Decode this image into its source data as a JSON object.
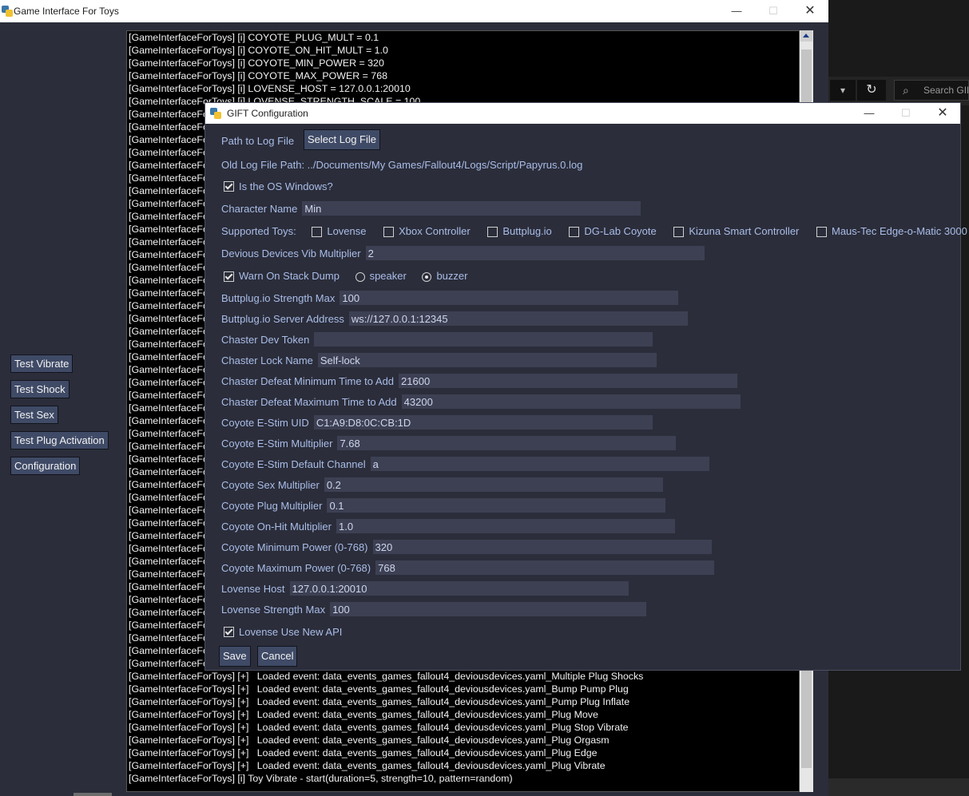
{
  "background_window": {
    "search_placeholder": "Search GIFT",
    "refresh_icon": "refresh-icon",
    "dropdown_icon": "chevron-down-icon"
  },
  "main_window": {
    "title": "Game Interface For Toys",
    "buttons": [
      "Test Vibrate",
      "Test Shock",
      "Test Sex",
      "Test Plug Activation",
      "Configuration"
    ],
    "log_lines": [
      "[GameInterfaceForToys] [i] COYOTE_PLUG_MULT = 0.1",
      "[GameInterfaceForToys] [i] COYOTE_ON_HIT_MULT = 1.0",
      "[GameInterfaceForToys] [i] COYOTE_MIN_POWER = 320",
      "[GameInterfaceForToys] [i] COYOTE_MAX_POWER = 768",
      "[GameInterfaceForToys] [i] LOVENSE_HOST = 127.0.0.1:20010",
      "[GameInterfaceForToys] [i] LOVENSE_STRENGTH_SCALE = 100",
      "[GameInterfaceForToys]",
      "[GameInterfaceForToys]",
      "[GameInterfaceForToys]",
      "[GameInterfaceForToys]",
      "[GameInterfaceForToys]",
      "[GameInterfaceForToys]",
      "[GameInterfaceForToys]",
      "[GameInterfaceForToys]",
      "[GameInterfaceForToys]",
      "[GameInterfaceForToys]",
      "[GameInterfaceForToys]",
      "[GameInterfaceForToys]",
      "[GameInterfaceForToys]",
      "[GameInterfaceForToys]",
      "[GameInterfaceForToys]",
      "[GameInterfaceForToys]",
      "[GameInterfaceForToys]",
      "[GameInterfaceForToys]",
      "[GameInterfaceForToys]",
      "[GameInterfaceForToys]",
      "[GameInterfaceForToys]",
      "[GameInterfaceForToys]",
      "[GameInterfaceForToys]",
      "[GameInterfaceForToys]",
      "[GameInterfaceForToys]",
      "[GameInterfaceForToys]",
      "[GameInterfaceForToys]",
      "[GameInterfaceForToys]",
      "[GameInterfaceForToys]",
      "[GameInterfaceForToys]",
      "[GameInterfaceForToys]",
      "[GameInterfaceForToys]",
      "[GameInterfaceForToys]",
      "[GameInterfaceForToys]",
      "[GameInterfaceForToys]",
      "[GameInterfaceForToys]",
      "[GameInterfaceForToys]",
      "[GameInterfaceForToys]",
      "[GameInterfaceForToys]",
      "[GameInterfaceForToys]",
      "[GameInterfaceForToys]",
      "[GameInterfaceForToys]",
      "[GameInterfaceForToys]",
      "[GameInterfaceForToys]",
      "[GameInterfaceForToys] [+]   Loaded event: data_events_games_fallout4_deviousdevices.yaml_Multiple Plug Shocks",
      "[GameInterfaceForToys] [+]   Loaded event: data_events_games_fallout4_deviousdevices.yaml_Bump Pump Plug",
      "[GameInterfaceForToys] [+]   Loaded event: data_events_games_fallout4_deviousdevices.yaml_Pump Plug Inflate",
      "[GameInterfaceForToys] [+]   Loaded event: data_events_games_fallout4_deviousdevices.yaml_Plug Move",
      "[GameInterfaceForToys] [+]   Loaded event: data_events_games_fallout4_deviousdevices.yaml_Plug Stop Vibrate",
      "[GameInterfaceForToys] [+]   Loaded event: data_events_games_fallout4_deviousdevices.yaml_Plug Orgasm",
      "[GameInterfaceForToys] [+]   Loaded event: data_events_games_fallout4_deviousdevices.yaml_Plug Edge",
      "[GameInterfaceForToys] [+]   Loaded event: data_events_games_fallout4_deviousdevices.yaml_Plug Vibrate",
      "[GameInterfaceForToys] [i] Toy Vibrate - start(duration=5, strength=10, pattern=random)"
    ]
  },
  "config": {
    "title": "GIFT Configuration",
    "path_label": "Path to Log File",
    "select_button": "Select Log File",
    "old_path": "Old Log File Path: ../Documents/My Games/Fallout4/Logs/Script/Papyrus.0.log",
    "is_windows": {
      "label": "Is the OS Windows?",
      "checked": true
    },
    "character_name": {
      "label": "Character Name",
      "value": "Min"
    },
    "supported_toys_label": "Supported Toys:",
    "toys": [
      {
        "label": "Lovense",
        "checked": false
      },
      {
        "label": "Xbox Controller",
        "checked": false
      },
      {
        "label": "Buttplug.io",
        "checked": false
      },
      {
        "label": "DG-Lab Coyote",
        "checked": false
      },
      {
        "label": "Kizuna Smart Controller",
        "checked": false
      },
      {
        "label": "Maus-Tec Edge-o-Matic 3000",
        "checked": false
      }
    ],
    "dd_vib": {
      "label": "Devious Devices Vib Multiplier",
      "value": "2"
    },
    "warn_stack": {
      "label": "Warn On Stack Dump",
      "checked": true
    },
    "radio_speaker": {
      "label": "speaker",
      "checked": false
    },
    "radio_buzzer": {
      "label": "buzzer",
      "checked": true
    },
    "bp_strength": {
      "label": "Buttplug.io Strength Max",
      "value": "100"
    },
    "bp_server": {
      "label": "Buttplug.io Server Address",
      "value": "ws://127.0.0.1:12345"
    },
    "chaster_token": {
      "label": "Chaster Dev Token",
      "value": ""
    },
    "chaster_lock": {
      "label": "Chaster Lock Name",
      "value": "Self-lock"
    },
    "chaster_min": {
      "label": "Chaster Defeat Minimum Time to Add",
      "value": "21600"
    },
    "chaster_max": {
      "label": "Chaster Defeat Maximum Time to Add",
      "value": "43200"
    },
    "coyote_uid": {
      "label": "Coyote E-Stim UID",
      "value": "C1:A9:D8:0C:CB:1D"
    },
    "coyote_mult": {
      "label": "Coyote E-Stim Multiplier",
      "value": "7.68"
    },
    "coyote_channel": {
      "label": "Coyote E-Stim Default Channel",
      "value": "a"
    },
    "coyote_sex": {
      "label": "Coyote Sex Multiplier",
      "value": "0.2"
    },
    "coyote_plug": {
      "label": "Coyote Plug Multiplier",
      "value": "0.1"
    },
    "coyote_hit": {
      "label": "Coyote On-Hit Multiplier",
      "value": "1.0"
    },
    "coyote_minp": {
      "label": "Coyote Minimum Power (0-768)",
      "value": "320"
    },
    "coyote_maxp": {
      "label": "Coyote Maximum Power (0-768)",
      "value": "768"
    },
    "lovense_host": {
      "label": "Lovense Host",
      "value": "127.0.0.1:20010"
    },
    "lovense_strength": {
      "label": "Lovense Strength Max",
      "value": "100"
    },
    "lovense_api": {
      "label": "Lovense Use New API",
      "checked": true
    },
    "save_button": "Save",
    "cancel_button": "Cancel"
  },
  "colors": {
    "window_bg": "#2b2d3a",
    "label_text": "#a9bde8",
    "input_bg": "#3d4053",
    "button_bg": "#3f4a66"
  }
}
